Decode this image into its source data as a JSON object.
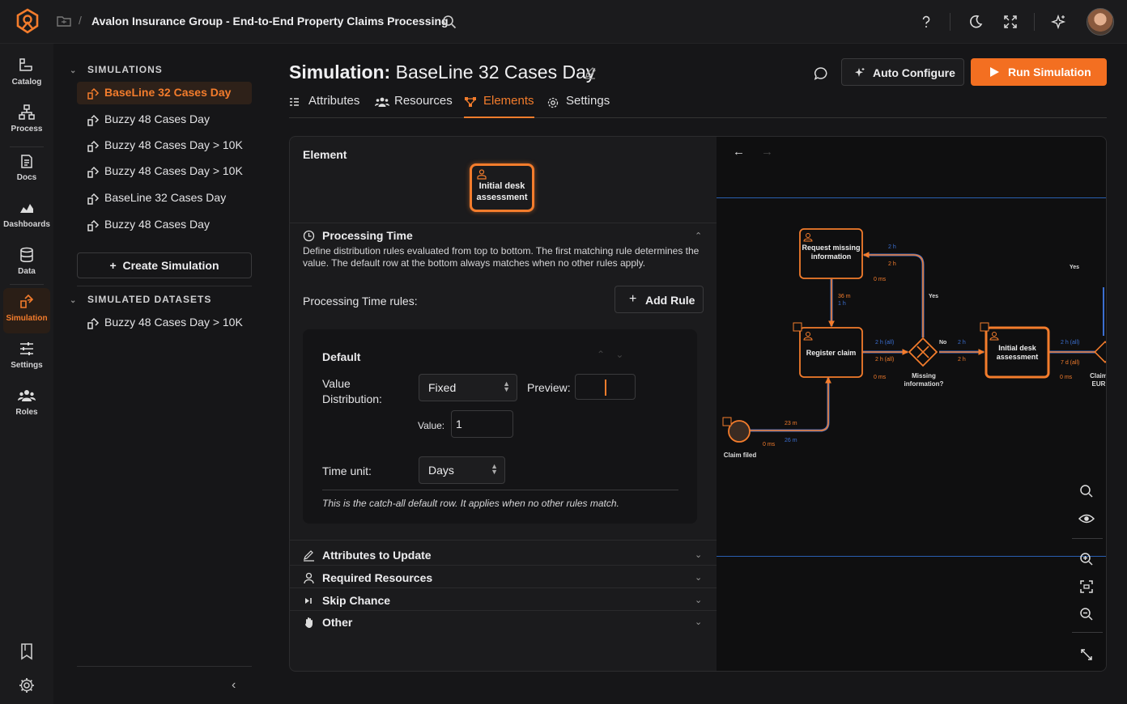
{
  "header": {
    "breadcrumb": "Avalon Insurance Group - End-to-End Property Claims Processing",
    "crumb_sep": "/"
  },
  "rail": [
    {
      "label": "Catalog",
      "icon": "catalog-icon"
    },
    {
      "label": "Process",
      "icon": "process-icon"
    },
    {
      "label": "Docs",
      "icon": "docs-icon"
    },
    {
      "label": "Dashboards",
      "icon": "dashboards-icon"
    },
    {
      "label": "Data",
      "icon": "data-icon"
    },
    {
      "label": "Simulation",
      "icon": "simulation-icon",
      "active": true
    },
    {
      "label": "Settings",
      "icon": "settings-sliders-icon"
    },
    {
      "label": "Roles",
      "icon": "roles-icon"
    }
  ],
  "sidebar": {
    "simulations_header": "SIMULATIONS",
    "simulations": [
      {
        "label": "BaseLine 32 Cases Day",
        "active": true
      },
      {
        "label": "Buzzy 48 Cases Day"
      },
      {
        "label": "Buzzy 48 Cases Day > 10K"
      },
      {
        "label": "Buzzy 48 Cases Day > 10K"
      },
      {
        "label": "BaseLine 32 Cases Day"
      },
      {
        "label": "Buzzy 48 Cases Day"
      }
    ],
    "create_label": "Create Simulation",
    "datasets_header": "SIMULATED DATASETS",
    "datasets": [
      {
        "label": "Buzzy 48 Cases Day > 10K"
      }
    ]
  },
  "page": {
    "title_prefix": "Simulation:",
    "title_name": "BaseLine 32 Cases Day",
    "auto_configure": "Auto Configure",
    "run_simulation": "Run Simulation",
    "tabs": [
      {
        "label": "Attributes"
      },
      {
        "label": "Resources"
      },
      {
        "label": "Elements",
        "active": true
      },
      {
        "label": "Settings"
      }
    ]
  },
  "element": {
    "header": "Element",
    "node_label": "Initial desk assessment",
    "processing_time": {
      "title": "Processing Time",
      "help": "Define distribution rules evaluated from top to bottom. The first matching rule determines the value. The default row at the bottom always matches when no other rules apply.",
      "rules_label": "Processing Time rules:",
      "add_rule": "Add Rule",
      "default_card": {
        "title": "Default",
        "value_distribution_label": "Value Distribution:",
        "distribution": "Fixed",
        "preview_label": "Preview:",
        "value_label": "Value:",
        "value": "1",
        "time_unit_label": "Time unit:",
        "time_unit": "Days",
        "note": "This is the catch-all default row. It applies when no other rules match."
      }
    },
    "sections": [
      {
        "title": "Attributes to Update",
        "icon": "pencil-icon"
      },
      {
        "title": "Required Resources",
        "icon": "person-icon"
      },
      {
        "title": "Skip Chance",
        "icon": "skip-icon"
      },
      {
        "title": "Other",
        "icon": "hand-icon"
      }
    ]
  },
  "diagram": {
    "nodes": {
      "request": "Request missing information",
      "register": "Register claim",
      "initial": "Initial desk assessment",
      "gateway": "Missing information?",
      "start": "Claim filed",
      "claim_cut": "Claim EUR"
    },
    "labels": {
      "yes1": "Yes",
      "yes2": "Yes",
      "no": "No",
      "t_2h_a": "2 h",
      "t_2h_b": "2 h",
      "t_0ms_a": "0 ms",
      "t_36m": "36 m",
      "t_1h": "1 h",
      "t_2hall_a": "2 h (all)",
      "t_2hall_b": "2 h (all)",
      "t_0ms_b": "0 ms",
      "t_2h_c": "2 h",
      "t_2h_d": "2 h",
      "t_2hall_c": "2 h (all)",
      "t_7dall": "7 d (all)",
      "t_0ms_c": "0 ms",
      "t_23m": "23 m",
      "t_26m": "26 m",
      "t_0ms_d": "0 ms"
    }
  },
  "colors": {
    "accent": "#f37c2c",
    "flow_blue": "#3b6fd1",
    "background": "#161618"
  }
}
